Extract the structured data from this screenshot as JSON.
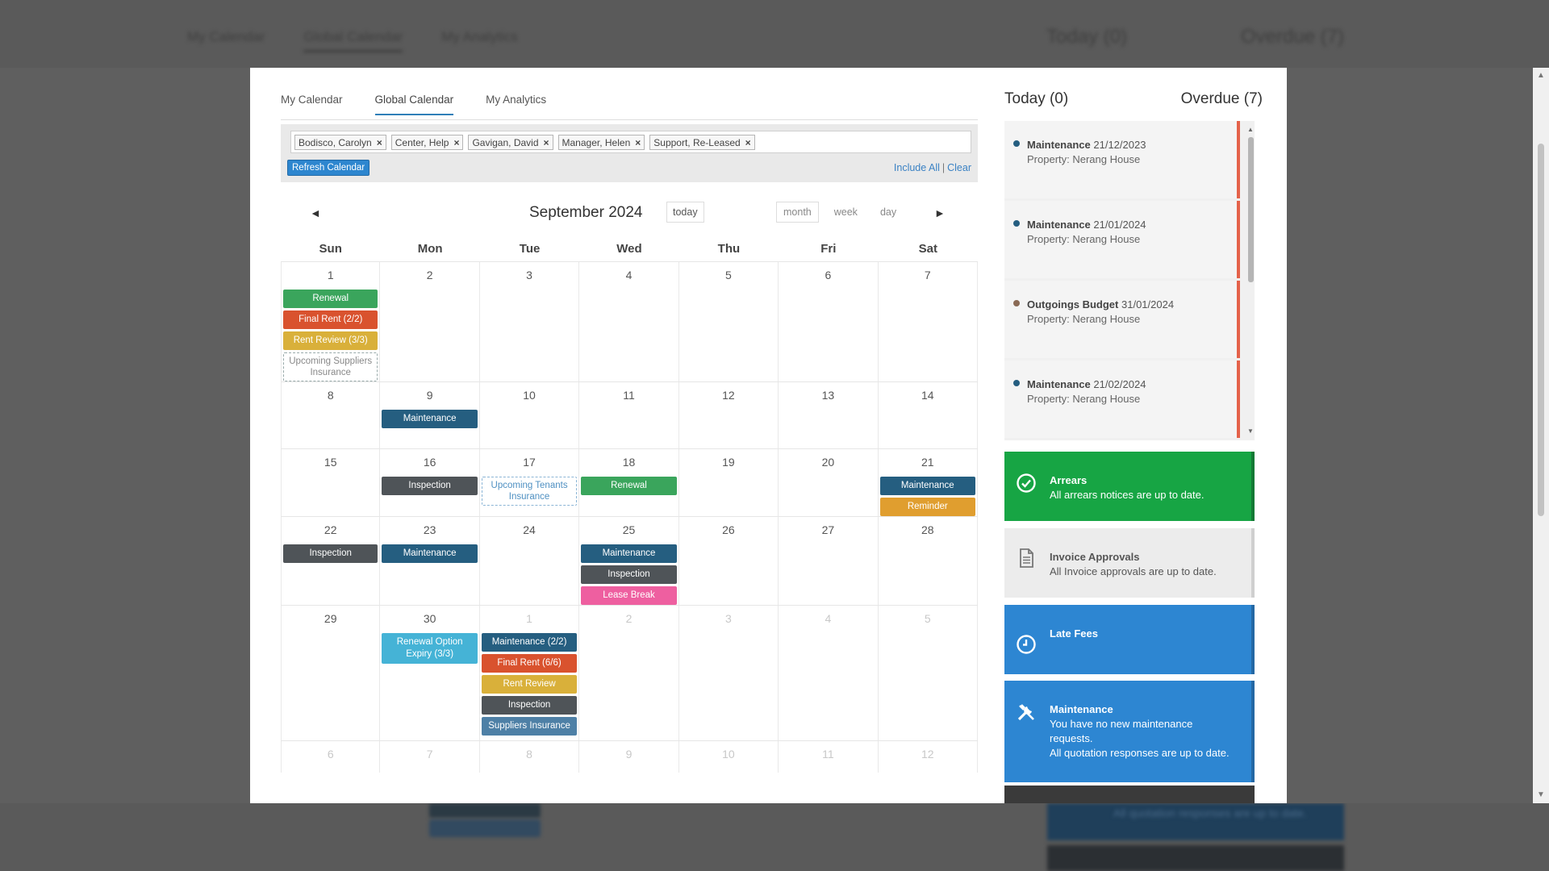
{
  "backdrop": {
    "tabs": [
      "My Calendar",
      "Global Calendar",
      "My Analytics"
    ],
    "today": "Today (0)",
    "overdue": "Overdue (7)",
    "bottom_text": "All quotation responses are up to date."
  },
  "tabs": [
    {
      "label": "My Calendar",
      "active": false
    },
    {
      "label": "Global Calendar",
      "active": true
    },
    {
      "label": "My Analytics",
      "active": false
    }
  ],
  "filters": {
    "chips": [
      "Bodisco, Carolyn",
      "Center, Help",
      "Gavigan, David",
      "Manager, Helen",
      "Support, Re-Leased"
    ],
    "remove_glyph": "×",
    "refresh_label": "Refresh Calendar",
    "include_all": "Include All",
    "separator": "|",
    "clear": "Clear"
  },
  "calendar": {
    "title": "September 2024",
    "prev_glyph": "◄",
    "next_glyph": "►",
    "today_label": "today",
    "views": [
      "month",
      "week",
      "day"
    ],
    "active_view": "month",
    "dow": [
      "Sun",
      "Mon",
      "Tue",
      "Wed",
      "Thu",
      "Fri",
      "Sat"
    ],
    "weeks": [
      {
        "min_height": 128,
        "days": [
          {
            "num": "1",
            "events": [
              {
                "label": "Renewal",
                "color": "#3aa55c"
              },
              {
                "label": "Final Rent (2/2)",
                "color": "#d9522e"
              },
              {
                "label": "Rent Review (3/3)",
                "color": "#d9b03a"
              },
              {
                "label": "Upcoming Suppliers Insurance",
                "style": "dashed"
              }
            ]
          },
          {
            "num": "2",
            "events": []
          },
          {
            "num": "3",
            "events": []
          },
          {
            "num": "4",
            "events": []
          },
          {
            "num": "5",
            "events": []
          },
          {
            "num": "6",
            "events": []
          },
          {
            "num": "7",
            "events": []
          }
        ]
      },
      {
        "min_height": 83,
        "days": [
          {
            "num": "8",
            "events": []
          },
          {
            "num": "9",
            "events": [
              {
                "label": "Maintenance",
                "color": "#255e80"
              }
            ]
          },
          {
            "num": "10",
            "events": []
          },
          {
            "num": "11",
            "events": []
          },
          {
            "num": "12",
            "events": []
          },
          {
            "num": "13",
            "events": []
          },
          {
            "num": "14",
            "events": []
          }
        ]
      },
      {
        "min_height": 83,
        "days": [
          {
            "num": "15",
            "events": []
          },
          {
            "num": "16",
            "events": [
              {
                "label": "Inspection",
                "color": "#4f5458"
              }
            ]
          },
          {
            "num": "17",
            "events": [
              {
                "label": "Upcoming Tenants Insurance",
                "style": "dashed-blue"
              }
            ]
          },
          {
            "num": "18",
            "events": [
              {
                "label": "Renewal",
                "color": "#3aa55c"
              }
            ]
          },
          {
            "num": "19",
            "events": []
          },
          {
            "num": "20",
            "events": []
          },
          {
            "num": "21",
            "events": [
              {
                "label": "Maintenance",
                "color": "#255e80"
              },
              {
                "label": "Reminder",
                "color": "#e09e2f"
              }
            ]
          }
        ]
      },
      {
        "min_height": 95,
        "days": [
          {
            "num": "22",
            "events": [
              {
                "label": "Inspection",
                "color": "#4f5458"
              }
            ]
          },
          {
            "num": "23",
            "events": [
              {
                "label": "Maintenance",
                "color": "#255e80"
              }
            ]
          },
          {
            "num": "24",
            "events": []
          },
          {
            "num": "25",
            "events": [
              {
                "label": "Maintenance",
                "color": "#255e80"
              },
              {
                "label": "Inspection",
                "color": "#4f5458"
              },
              {
                "label": "Lease Break",
                "color": "#ee5fa0"
              }
            ]
          },
          {
            "num": "26",
            "events": []
          },
          {
            "num": "27",
            "events": []
          },
          {
            "num": "28",
            "events": []
          }
        ]
      },
      {
        "min_height": 168,
        "days": [
          {
            "num": "29",
            "events": []
          },
          {
            "num": "30",
            "events": [
              {
                "label": "Renewal Option Expiry (3/3)",
                "color": "#45b3d6"
              }
            ]
          },
          {
            "num": "1",
            "other": true,
            "events": [
              {
                "label": "Maintenance (2/2)",
                "color": "#255e80"
              },
              {
                "label": "Final Rent (6/6)",
                "color": "#d9522e"
              },
              {
                "label": "Rent Review",
                "color": "#d9b03a"
              },
              {
                "label": "Inspection",
                "color": "#4f5458"
              },
              {
                "label": "Suppliers Insurance",
                "color": "#4e80a6"
              }
            ]
          },
          {
            "num": "2",
            "other": true,
            "events": []
          },
          {
            "num": "3",
            "other": true,
            "events": []
          },
          {
            "num": "4",
            "other": true,
            "events": []
          },
          {
            "num": "5",
            "other": true,
            "events": []
          }
        ]
      },
      {
        "min_height": 40,
        "days": [
          {
            "num": "6",
            "other": true,
            "events": []
          },
          {
            "num": "7",
            "other": true,
            "events": []
          },
          {
            "num": "8",
            "other": true,
            "events": []
          },
          {
            "num": "9",
            "other": true,
            "events": []
          },
          {
            "num": "10",
            "other": true,
            "events": []
          },
          {
            "num": "11",
            "other": true,
            "events": []
          },
          {
            "num": "12",
            "other": true,
            "events": []
          }
        ]
      }
    ]
  },
  "right_panel": {
    "today": "Today (0)",
    "overdue": "Overdue (7)",
    "overdue_items": [
      {
        "type": "Maintenance",
        "date": "21/12/2023",
        "property": "Property: Nerang House",
        "dot": "#255e80"
      },
      {
        "type": "Maintenance",
        "date": "21/01/2024",
        "property": "Property: Nerang House",
        "dot": "#255e80"
      },
      {
        "type": "Outgoings Budget",
        "date": "31/01/2024",
        "property": "Property: Nerang House",
        "dot": "#8a6a55"
      },
      {
        "type": "Maintenance",
        "date": "21/02/2024",
        "property": "Property: Nerang House",
        "dot": "#255e80"
      }
    ],
    "cards": [
      {
        "title": "Arrears",
        "text": "All arrears notices are up to date.",
        "icon": "check-circle-icon",
        "color": "#17a544"
      },
      {
        "title": "Invoice Approvals",
        "text": "All Invoice approvals are up to date.",
        "icon": "document-icon",
        "color": "#ececec"
      },
      {
        "title": "Late Fees",
        "text": "",
        "icon": "clock-icon",
        "color": "#2d86d2"
      },
      {
        "title": "Maintenance",
        "text": "You have no new maintenance requests.",
        "text2": "All quotation responses are up to date.",
        "icon": "tools-icon",
        "color": "#2d86d2"
      }
    ]
  }
}
